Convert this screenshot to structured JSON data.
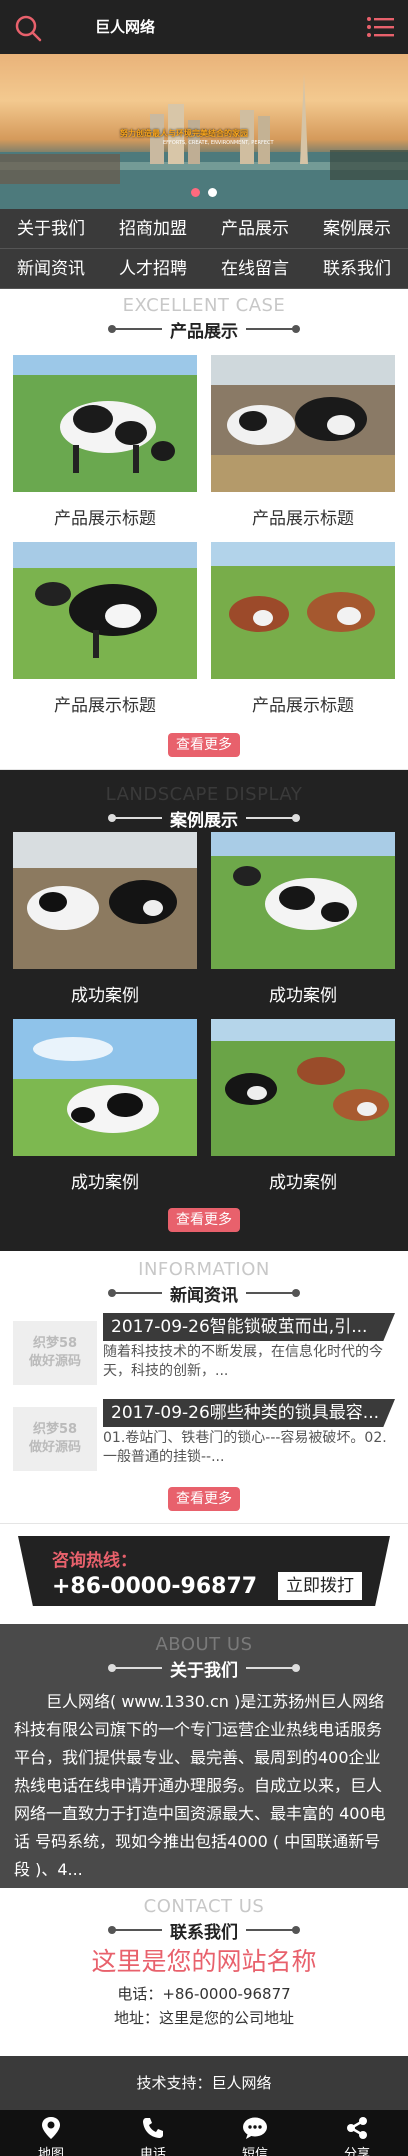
{
  "header": {
    "title": "巨人网络",
    "search_icon": "search-icon",
    "menu_icon": "menu-icon",
    "accent": "#e8616c"
  },
  "banner": {
    "slogan": "努力创造最人与环境完美结合的家园",
    "slogan_en": "EFFORTS, CREATE, ENVIRONMENT, PERFECT",
    "slides": 2,
    "active_slide": 1
  },
  "nav": [
    "关于我们",
    "招商加盟",
    "产品展示",
    "案例展示",
    "新闻资讯",
    "人才招聘",
    "在线留言",
    "联系我们"
  ],
  "products": {
    "en": "EXCELLENT CASE",
    "cn": "产品展示",
    "items": [
      "产品展示标题",
      "产品展示标题",
      "产品展示标题",
      "产品展示标题"
    ],
    "more": "查看更多"
  },
  "cases": {
    "en": "LANDSCAPE DISPLAY",
    "cn": "案例展示",
    "items": [
      "成功案例",
      "成功案例",
      "成功案例",
      "成功案例"
    ],
    "more": "查看更多"
  },
  "news": {
    "en": "INFORMATION",
    "cn": "新闻资讯",
    "thumb_line1": "织梦58",
    "thumb_line2": "做好源码",
    "items": [
      {
        "title": "2017-09-26智能锁破茧而出,引...",
        "desc": "随着科技技术的不断发展，在信息化时代的今天，科技的创新，..."
      },
      {
        "title": "2017-09-26哪些种类的锁具最容...",
        "desc": "01.卷站门、铁巷门的锁心---容易被破坏。02.一般普通的挂锁--..."
      }
    ],
    "more": "查看更多"
  },
  "hotline": {
    "label": "咨询热线：",
    "number": "+86-0000-96877",
    "call": "立即拨打"
  },
  "about": {
    "en": "ABOUT US",
    "cn": "关于我们",
    "text": "巨人网络( www.1330.cn )是江苏扬州巨人网络科技有限公司旗下的一个专门运营企业热线电话服务平台，我们提供最专业、最完善、最周到的400企业热线电话在线申请开通办理服务。自成立以来，巨人网络一直致力于打造中国资源最大、最丰富的 400电话 号码系统，现如今推出包括4000 ( 中国联通新号段 )、4..."
  },
  "contact": {
    "en": "CONTACT US",
    "cn": "联系我们",
    "site": "这里是您的网站名称",
    "phone": "电话：+86-0000-96877",
    "address": "地址：这里是您的公司地址"
  },
  "footer": {
    "support": "技术支持：巨人网络"
  },
  "tabbar": [
    {
      "label": "地图",
      "icon": "map-pin-icon"
    },
    {
      "label": "电话",
      "icon": "phone-icon"
    },
    {
      "label": "短信",
      "icon": "message-icon"
    },
    {
      "label": "分享",
      "icon": "share-icon"
    }
  ]
}
